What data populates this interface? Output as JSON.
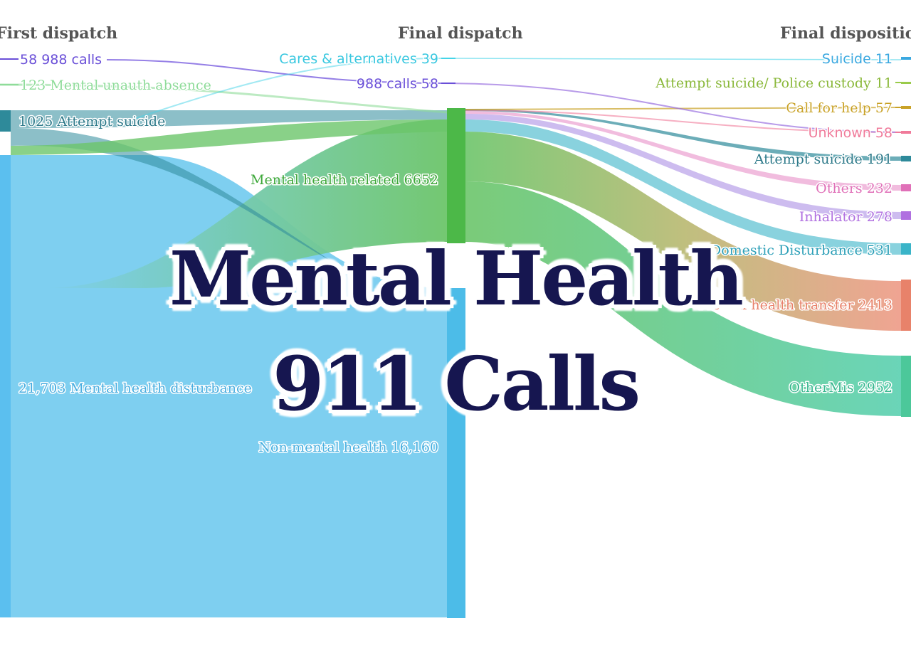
{
  "title_line1": "Mental Health",
  "title_line2": "911 Calls",
  "columns": {
    "first": "First dispatch",
    "final": "Final dispatch",
    "disposition": "Final disposition"
  },
  "nodes": {
    "calls988_first": {
      "label": "58 988 calls",
      "color": "#6a4fd8"
    },
    "unauth_first": {
      "label": "123 Mental unauth absence",
      "color": "#8fdc9a"
    },
    "attempt_first": {
      "label": "1025 Attempt suicide",
      "color": "#2e8a9a"
    },
    "mhd_first": {
      "label": "21,703 Mental health disturbance",
      "color": "#5bbfef"
    },
    "cares_final": {
      "label": "Cares & alternatives 39",
      "color": "#45d4e8"
    },
    "calls988_final": {
      "label": "988 calls 58",
      "color": "#6a4fd8"
    },
    "mhr_final": {
      "label": "Mental health related 6652",
      "color": "#4cb848"
    },
    "nonmh_final": {
      "label": "Non-mental health 16,160",
      "color": "#4cbce8"
    },
    "suicide": {
      "label": "Suicide 11",
      "color": "#3aa8e0"
    },
    "attempt_police": {
      "label": "Attempt suicide/ Police custody 11",
      "color": "#9acb4a"
    },
    "call_help": {
      "label": "Call for help 57",
      "color": "#c9a227"
    },
    "unknown": {
      "label": "Unknown 58",
      "color": "#f07a9a"
    },
    "attempt_suicide": {
      "label": "Attempt suicide 191",
      "color": "#2e8a9a"
    },
    "others": {
      "label": "Others 232",
      "color": "#e070b8"
    },
    "inhalator": {
      "label": "Inhalator 278",
      "color": "#b070e0"
    },
    "domestic": {
      "label": "Domestic Disturbance 531",
      "color": "#3ab4c8"
    },
    "transfer": {
      "label": "Mental health transfer 2413",
      "color": "#e8826a"
    },
    "othermis": {
      "label": "OtherMis 2952",
      "color": "#4cc89a"
    }
  }
}
